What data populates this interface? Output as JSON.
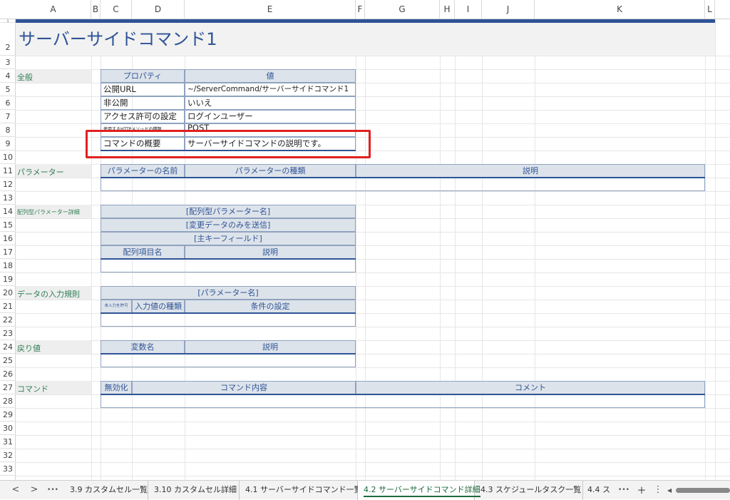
{
  "columns": [
    "A",
    "B",
    "C",
    "D",
    "E",
    "F",
    "G",
    "H",
    "I",
    "J",
    "K",
    "L"
  ],
  "rows": [
    "1",
    "2",
    "3",
    "4",
    "5",
    "6",
    "7",
    "8",
    "9",
    "10",
    "11",
    "12",
    "13",
    "14",
    "15",
    "16",
    "17",
    "18",
    "19",
    "20",
    "21",
    "22",
    "23",
    "24",
    "25",
    "26",
    "27",
    "28",
    "29",
    "30",
    "31",
    "32",
    "33"
  ],
  "title": "サーバーサイドコマンド1",
  "sections": {
    "general": "全般",
    "parameters": "パラメーター",
    "array_params": "配列型パラメーター詳細",
    "input_rules": "データの入力規則",
    "return_values": "戻り値",
    "commands": "コマンド"
  },
  "property_table": {
    "header_property": "プロパティ",
    "header_value": "値",
    "rows": [
      {
        "key": "公開URL",
        "value": "~/ServerCommand/サーバーサイドコマンド1"
      },
      {
        "key": "非公開",
        "value": "いいえ"
      },
      {
        "key": "アクセス許可の設定",
        "value": "ログインユーザー"
      },
      {
        "key": "使用するHTTPメソッドの種類",
        "value": "POST"
      },
      {
        "key": "コマンドの概要",
        "value": "サーバーサイドコマンドの説明です。"
      }
    ]
  },
  "param_table": {
    "name": "パラメーターの名前",
    "type": "パラメーターの種類",
    "desc": "説明"
  },
  "array_table": {
    "title": "[配列型パラメーター名]",
    "send_changed": "[変更データのみを送信]",
    "primary_key": "[主キーフィールド]",
    "item_name": "配列項目名",
    "desc": "説明"
  },
  "rule_table": {
    "title": "[パラメーター名]",
    "no_input": "未入力を許可",
    "value_type": "入力値の種類",
    "condition": "条件の設定"
  },
  "return_table": {
    "var_name": "変数名",
    "desc": "説明"
  },
  "command_table": {
    "disable": "無効化",
    "content": "コマンド内容",
    "comment": "コメント"
  },
  "tabs": [
    {
      "label": "3.9 カスタムセル一覧",
      "active": false
    },
    {
      "label": "3.10 カスタムセル詳細",
      "active": false
    },
    {
      "label": "4.1 サーバーサイドコマンド一覧",
      "active": false
    },
    {
      "label": "4.2 サーバーサイドコマンド詳細",
      "active": true
    },
    {
      "label": "4.3 スケジュールタスク一覧",
      "active": false
    },
    {
      "label": "4.4 ス",
      "active": false
    }
  ],
  "nav": {
    "prev": "<",
    "next": ">",
    "more": "•••",
    "add": "+",
    "menu": "⋮"
  },
  "colors": {
    "accent": "#2f5496",
    "highlight": "#e02020",
    "section_label": "#2f7f56",
    "header_fill": "#dde3ea"
  }
}
